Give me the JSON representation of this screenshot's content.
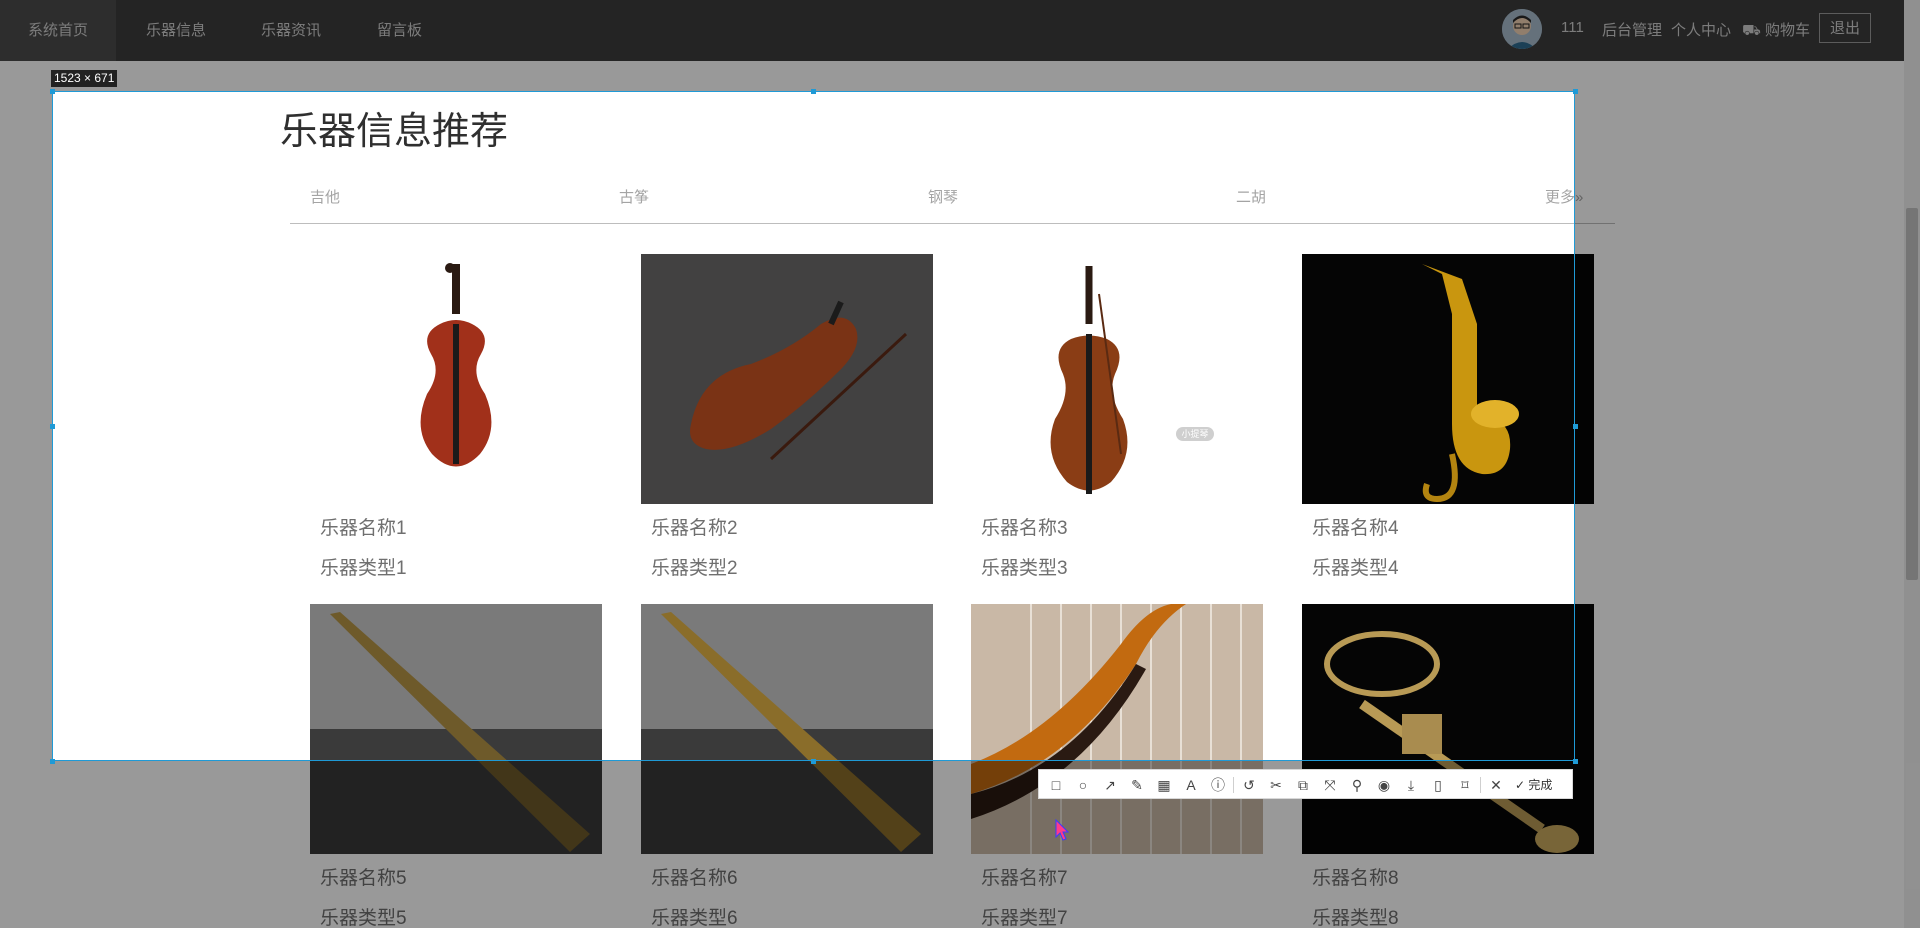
{
  "nav": {
    "items": [
      "系统首页",
      "乐器信息",
      "乐器资讯",
      "留言板"
    ],
    "username": "111",
    "admin": "后台管理",
    "profile": "个人中心",
    "cart": "购物车",
    "logout": "退出"
  },
  "section": {
    "title": "乐器信息推荐",
    "tabs": [
      "吉他",
      "古筝",
      "钢琴",
      "二胡"
    ],
    "more": "更多"
  },
  "products": [
    {
      "name": "乐器名称1",
      "type": "乐器类型1"
    },
    {
      "name": "乐器名称2",
      "type": "乐器类型2"
    },
    {
      "name": "乐器名称3",
      "type": "乐器类型3"
    },
    {
      "name": "乐器名称4",
      "type": "乐器类型4"
    },
    {
      "name": "乐器名称5",
      "type": "乐器类型5"
    },
    {
      "name": "乐器名称6",
      "type": "乐器类型6"
    },
    {
      "name": "乐器名称7",
      "type": "乐器类型7"
    },
    {
      "name": "乐器名称8",
      "type": "乐器类型8"
    }
  ],
  "capture_tool": {
    "size_label": "1523 × 671",
    "done_label": "完成",
    "tools": [
      "rectangle-icon",
      "ellipse-icon",
      "arrow-icon",
      "pencil-icon",
      "mosaic-icon",
      "text-icon",
      "numbered-marker-icon",
      "undo-icon",
      "scissors-icon",
      "ocr-icon",
      "translate-icon",
      "pin-icon",
      "record-icon",
      "download-icon",
      "long-screenshot-icon",
      "bookmark-icon",
      "close-icon",
      "check-icon"
    ]
  },
  "floating_badge": "小提琴"
}
